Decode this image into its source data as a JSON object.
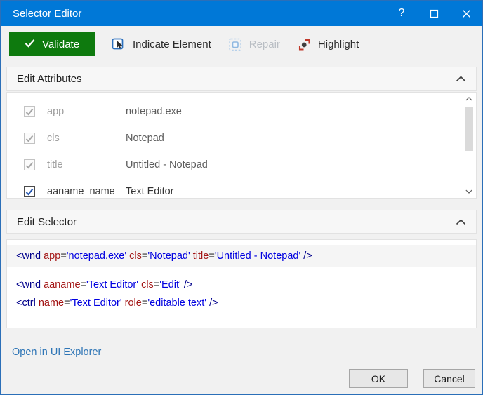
{
  "window": {
    "title": "Selector Editor",
    "accent_color": "#0078d7",
    "controls": {
      "help_glyph": "?",
      "help_icon": "help-icon",
      "maximize_icon": "maximize-icon",
      "close_icon": "close-icon"
    }
  },
  "toolbar": {
    "validate": {
      "label": "Validate",
      "icon": "check-icon",
      "color": "#0e7a0e"
    },
    "indicate": {
      "label": "Indicate Element",
      "icon": "indicate-element-icon",
      "icon_color": "#2a6fbd"
    },
    "repair": {
      "label": "Repair",
      "icon": "repair-icon",
      "disabled": true
    },
    "highlight": {
      "label": "Highlight",
      "icon": "highlight-icon",
      "icon_color": "#c0392b"
    }
  },
  "edit_attributes": {
    "header": "Edit Attributes",
    "collapse_icon": "chevron-up-icon",
    "rows": [
      {
        "checked": true,
        "enabled": false,
        "name": "app",
        "value": "notepad.exe"
      },
      {
        "checked": true,
        "enabled": false,
        "name": "cls",
        "value": "Notepad"
      },
      {
        "checked": true,
        "enabled": false,
        "name": "title",
        "value": "Untitled - Notepad"
      },
      {
        "checked": true,
        "enabled": true,
        "name": "aaname_name",
        "value": "Text Editor"
      }
    ]
  },
  "edit_selector": {
    "header": "Edit Selector",
    "collapse_icon": "chevron-up-icon",
    "colors": {
      "tag": "#00008b",
      "attr": "#a31515",
      "value": "#0000e0",
      "eq": "#333333"
    },
    "lines": [
      {
        "highlighted": true,
        "tokens": [
          {
            "c": "tag",
            "t": "<wnd"
          },
          {
            "c": "plain",
            "t": " "
          },
          {
            "c": "attr",
            "t": "app"
          },
          {
            "c": "eq",
            "t": "="
          },
          {
            "c": "val",
            "t": "'notepad.exe'"
          },
          {
            "c": "plain",
            "t": " "
          },
          {
            "c": "attr",
            "t": "cls"
          },
          {
            "c": "eq",
            "t": "="
          },
          {
            "c": "val",
            "t": "'Notepad'"
          },
          {
            "c": "plain",
            "t": " "
          },
          {
            "c": "attr",
            "t": "title"
          },
          {
            "c": "eq",
            "t": "="
          },
          {
            "c": "val",
            "t": "'Untitled - Notepad'"
          },
          {
            "c": "tag",
            "t": " />"
          }
        ]
      },
      {
        "highlighted": false,
        "tokens": [
          {
            "c": "tag",
            "t": "<wnd"
          },
          {
            "c": "plain",
            "t": " "
          },
          {
            "c": "attr",
            "t": "aaname"
          },
          {
            "c": "eq",
            "t": "="
          },
          {
            "c": "val",
            "t": "'Text Editor'"
          },
          {
            "c": "plain",
            "t": " "
          },
          {
            "c": "attr",
            "t": "cls"
          },
          {
            "c": "eq",
            "t": "="
          },
          {
            "c": "val",
            "t": "'Edit'"
          },
          {
            "c": "tag",
            "t": " />"
          }
        ]
      },
      {
        "highlighted": false,
        "tokens": [
          {
            "c": "tag",
            "t": "<ctrl"
          },
          {
            "c": "plain",
            "t": " "
          },
          {
            "c": "attr",
            "t": "name"
          },
          {
            "c": "eq",
            "t": "="
          },
          {
            "c": "val",
            "t": "'Text Editor'"
          },
          {
            "c": "plain",
            "t": " "
          },
          {
            "c": "attr",
            "t": "role"
          },
          {
            "c": "eq",
            "t": "="
          },
          {
            "c": "val",
            "t": "'editable text'"
          },
          {
            "c": "tag",
            "t": " />"
          }
        ]
      }
    ]
  },
  "footer": {
    "link": "Open in UI Explorer",
    "ok_label": "OK",
    "cancel_label": "Cancel"
  }
}
